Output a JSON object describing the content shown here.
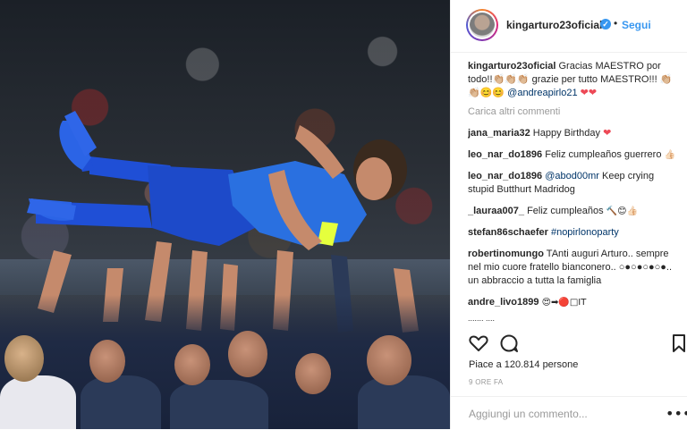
{
  "post": {
    "username": "kingarturo23oficial",
    "verified_icon": "verified-badge-icon",
    "separator": "•",
    "follow_label": "Segui",
    "caption": {
      "user": "kingarturo23oficial",
      "text": "Gracias MAESTRO por todo!!👏🏼👏🏼👏🏼 grazie per tutto MAESTRO!!! 👏🏼👏🏼😊😊",
      "mention": "@andreapirlo21",
      "hearts": "❤❤"
    },
    "load_more_label": "Carica altri commenti",
    "comments": [
      {
        "user": "jana_maria32",
        "text": "Happy Birthday",
        "suffix": "❤"
      },
      {
        "user": "leo_nar_do1896",
        "text": "Feliz cumpleaños guerrero",
        "suffix": "👍🏻"
      },
      {
        "user": "leo_nar_do1896",
        "text": "",
        "mention": "@abod00mr",
        "text2": "Keep crying stupid Butthurt Madridog"
      },
      {
        "user": "_lauraa007_",
        "text": "Feliz cumpleaños",
        "suffix": "🔨😊👍🏻"
      },
      {
        "user": "stefan86schaefer",
        "text": "",
        "mention": "#nopirlonoparty"
      },
      {
        "user": "robertinomungo",
        "text": "TAnti auguri Arturo.. sempre nel mio cuore fratello bianconero.. ○●○●○●○●.. un abbraccio a tutta la famiglia"
      },
      {
        "user": "andre_livo1899",
        "text": "😍➡🔴□IT"
      },
      {
        "user": "",
        "text": "....... ...."
      }
    ],
    "likes_text": "Piace a 120.814 persone",
    "timestamp": "9 ORE FA",
    "add_comment_placeholder": "Aggiungi un commento...",
    "more_options": "•••"
  },
  "icons": {
    "like": "heart-outline-icon",
    "comment": "comment-bubble-icon",
    "save": "bookmark-icon",
    "more": "more-options-icon"
  }
}
